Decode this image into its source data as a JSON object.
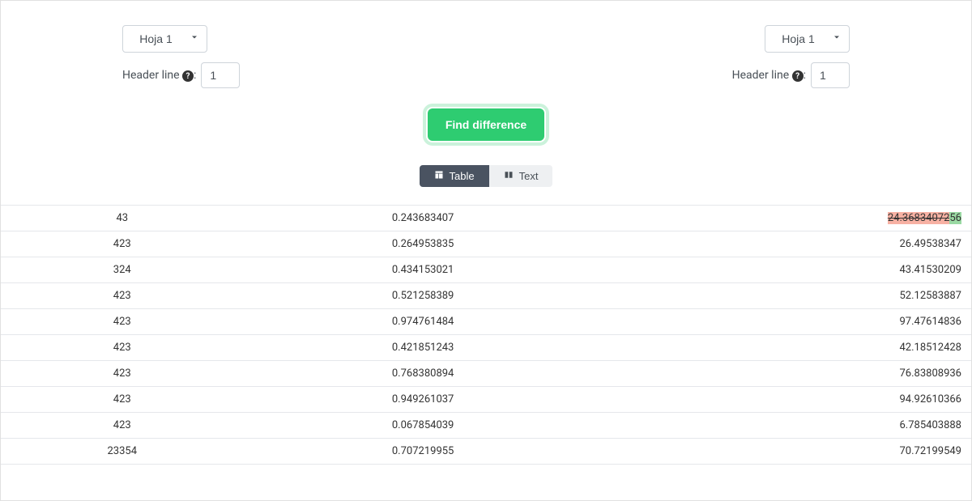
{
  "left": {
    "sheet_select": "Hoja 1",
    "headerline_label_prefix": "Header line ",
    "headerline_label_suffix": ":",
    "headerline_value": "1"
  },
  "right": {
    "sheet_select": "Hoja 1",
    "headerline_label_prefix": "Header line ",
    "headerline_label_suffix": ":",
    "headerline_value": "1"
  },
  "help_icon_char": "?",
  "find_button_label": "Find difference",
  "tabs": {
    "table": "Table",
    "text": "Text"
  },
  "rows": [
    {
      "a": "43",
      "b": "0.243683407",
      "c_del": "2",
      "c_mid": "4.36834072",
      "c_add": "56"
    },
    {
      "a": "423",
      "b": "0.264953835",
      "c_del": "",
      "c_mid": "26.49538347",
      "c_add": ""
    },
    {
      "a": "324",
      "b": "0.434153021",
      "c_del": "",
      "c_mid": "43.41530209",
      "c_add": ""
    },
    {
      "a": "423",
      "b": "0.521258389",
      "c_del": "",
      "c_mid": "52.12583887",
      "c_add": ""
    },
    {
      "a": "423",
      "b": "0.974761484",
      "c_del": "",
      "c_mid": "97.47614836",
      "c_add": ""
    },
    {
      "a": "423",
      "b": "0.421851243",
      "c_del": "",
      "c_mid": "42.18512428",
      "c_add": ""
    },
    {
      "a": "423",
      "b": "0.768380894",
      "c_del": "",
      "c_mid": "76.83808936",
      "c_add": ""
    },
    {
      "a": "423",
      "b": "0.949261037",
      "c_del": "",
      "c_mid": "94.92610366",
      "c_add": ""
    },
    {
      "a": "423",
      "b": "0.067854039",
      "c_del": "",
      "c_mid": "6.785403888",
      "c_add": ""
    },
    {
      "a": "23354",
      "b": "0.707219955",
      "c_del": "",
      "c_mid": "70.72199549",
      "c_add": ""
    }
  ]
}
